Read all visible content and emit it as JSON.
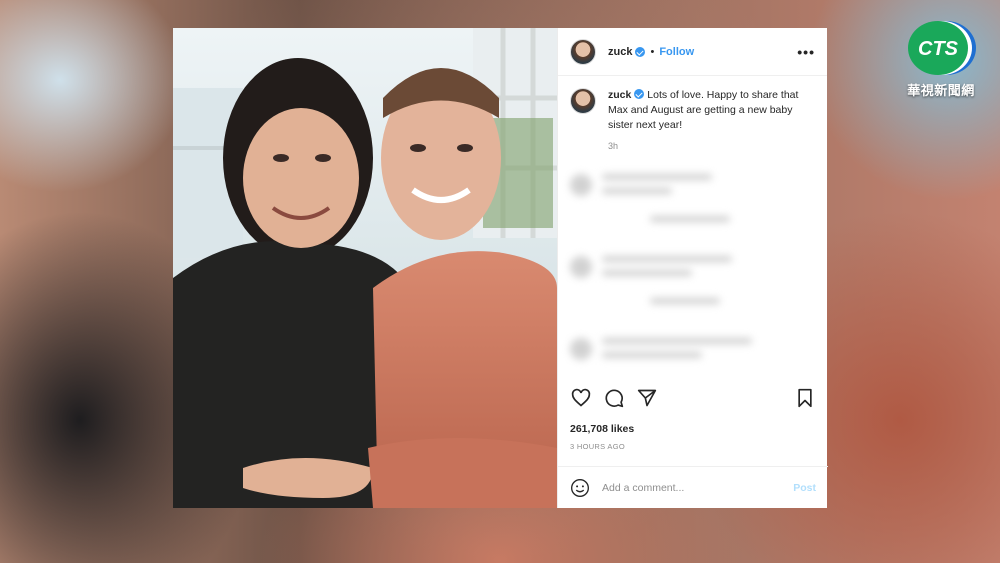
{
  "post": {
    "username": "zuck",
    "follow_label": "Follow",
    "dot": "•",
    "more": "•••",
    "caption_user": "zuck",
    "caption_text": "Lots of love. Happy to share that Max and August are getting a new baby sister next year!",
    "caption_time": "3h",
    "likes": "261,708 likes",
    "time_ago": "3 HOURS AGO",
    "comment_placeholder": "Add a comment...",
    "post_label": "Post"
  },
  "icons": {
    "like": "heart-icon",
    "comment": "comment-icon",
    "share": "paper-plane-icon",
    "save": "bookmark-icon",
    "emoji": "smiley-icon",
    "verified": "verified-badge-icon"
  },
  "colors": {
    "instagram_blue": "#3897f0",
    "post_disabled": "#b2dffc",
    "cts_green": "#1aa85a",
    "cts_blue": "#1f6fd1"
  },
  "broadcaster": {
    "logo_text": "CTS",
    "channel_name": "華視新聞網"
  }
}
